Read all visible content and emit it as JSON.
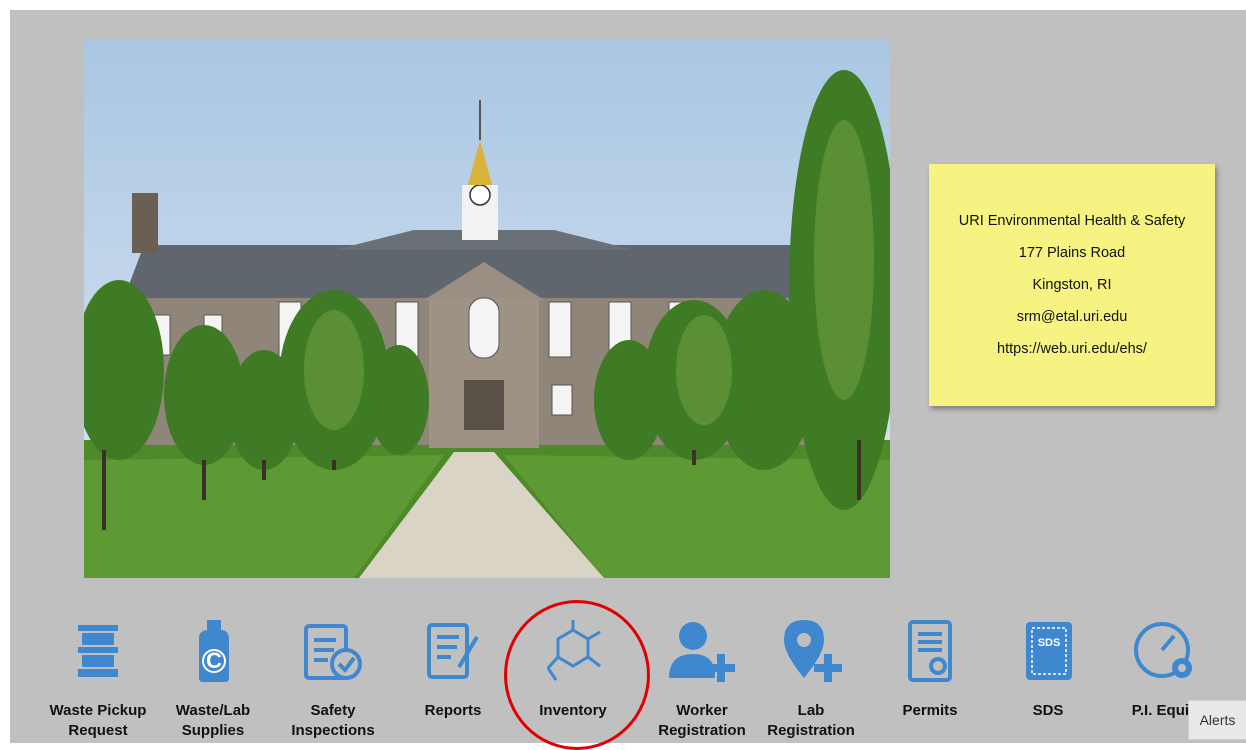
{
  "photo": {
    "alt": "Campus building photo"
  },
  "contact": {
    "org": "URI Environmental Health & Safety",
    "address": "177 Plains Road",
    "city": "Kingston, RI",
    "email": "srm@etal.uri.edu",
    "url": "https://web.uri.edu/ehs/"
  },
  "tiles": [
    {
      "label": "Waste Pickup\nRequest",
      "icon": "waste-drum-icon"
    },
    {
      "label": "Waste/Lab\nSupplies",
      "icon": "jug-icon"
    },
    {
      "label": "Safety\nInspections",
      "icon": "checklist-icon"
    },
    {
      "label": "Reports",
      "icon": "report-edit-icon"
    },
    {
      "label": "Inventory",
      "icon": "molecule-icon"
    },
    {
      "label": "Worker\nRegistration",
      "icon": "add-user-icon"
    },
    {
      "label": "Lab\nRegistration",
      "icon": "add-location-icon"
    },
    {
      "label": "Permits",
      "icon": "permit-document-icon"
    },
    {
      "label": "SDS",
      "icon": "sds-binder-icon"
    },
    {
      "label": "P.I. Equip",
      "icon": "gauge-gear-icon"
    }
  ],
  "alerts_label": "Alerts",
  "colors": {
    "icon": "#3f88cf",
    "highlight": "#e10000",
    "note": "#f7f383"
  }
}
